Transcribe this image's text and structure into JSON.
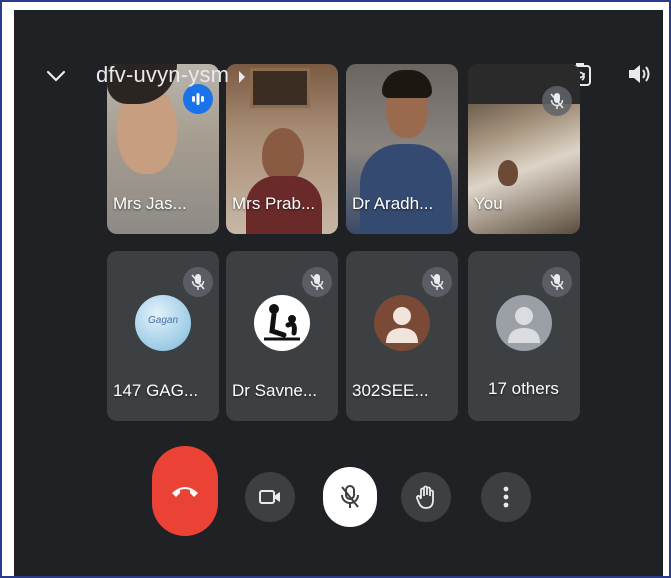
{
  "header": {
    "meeting_code": "dfv-uvyn-ysm",
    "collapse_icon": "chevron-down-icon",
    "switch_camera_icon": "switch-camera-icon",
    "speaker_icon": "speaker-icon"
  },
  "participants": [
    {
      "label": "Mrs Jas...",
      "state": "speaking"
    },
    {
      "label": "Mrs Prab...",
      "state": "video"
    },
    {
      "label": "Dr Aradh...",
      "state": "video"
    },
    {
      "label": "You",
      "state": "muted"
    },
    {
      "label": "147 GAG...",
      "state": "muted",
      "avatar_text": "Gagan"
    },
    {
      "label": "Dr Savne...",
      "state": "muted"
    },
    {
      "label": "302SEE...",
      "state": "muted"
    },
    {
      "label": "17 others",
      "state": "muted"
    }
  ],
  "controls": {
    "end_call_icon": "end-call-icon",
    "camera_icon": "camera-off-icon",
    "mic_icon": "mic-off-icon",
    "hand_icon": "raise-hand-icon",
    "more_icon": "more-vert-icon"
  },
  "colors": {
    "background": "#202124",
    "tile": "#3c4043",
    "end_call": "#ea4335",
    "speaking": "#1a73e8"
  }
}
